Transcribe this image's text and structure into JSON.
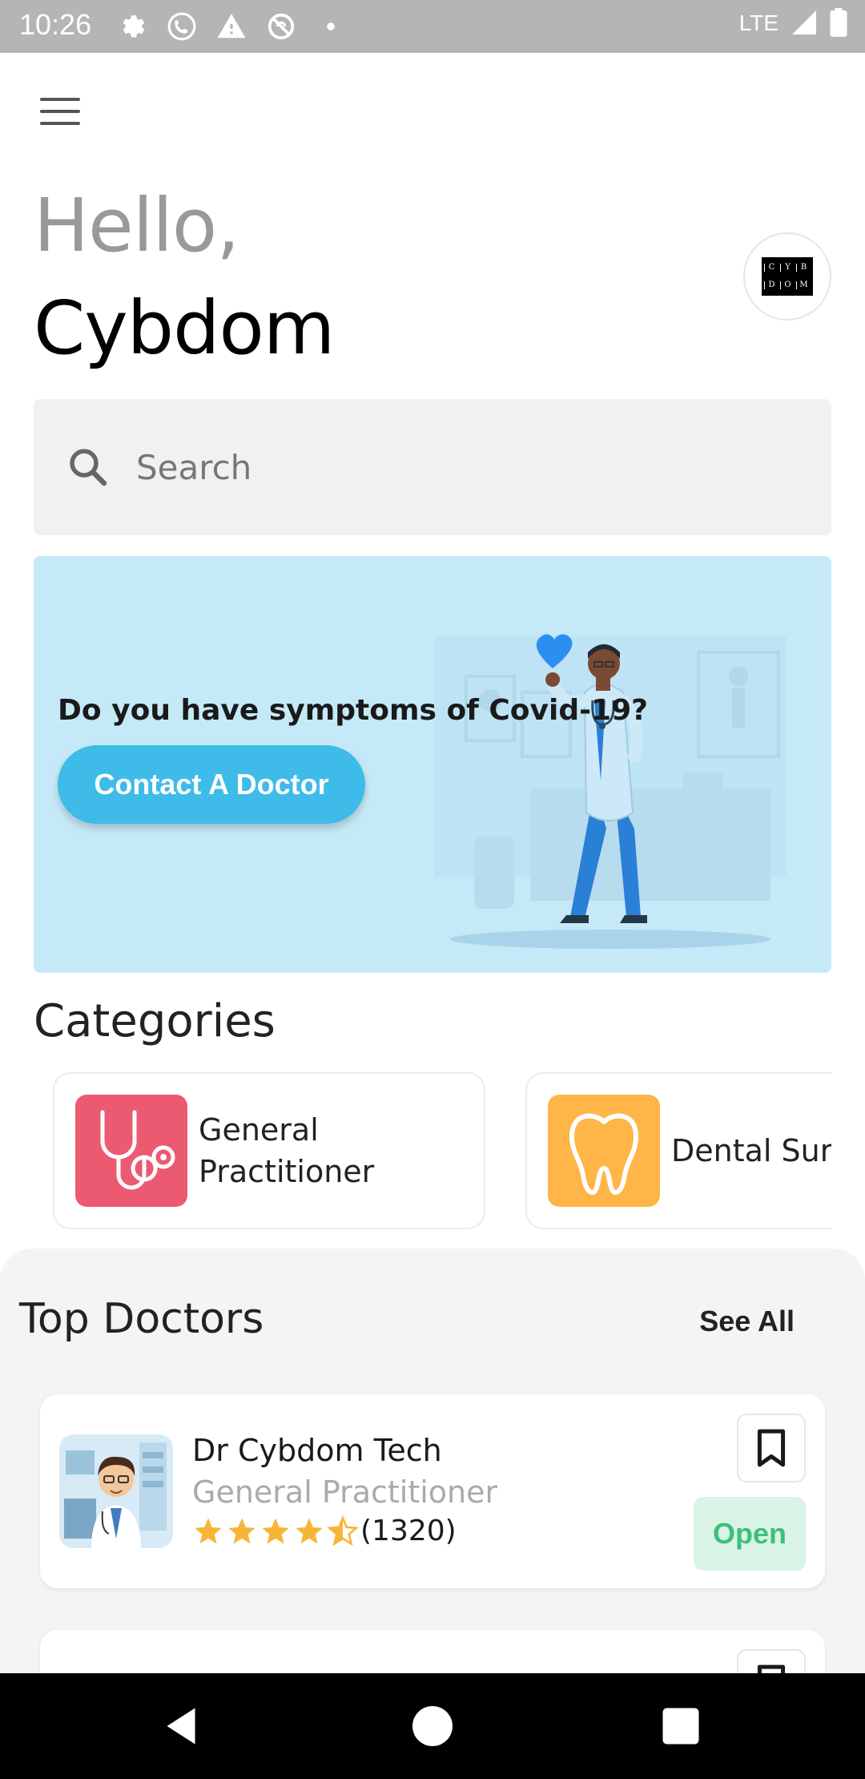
{
  "status_bar": {
    "time": "10:26",
    "network": "LTE",
    "icons": [
      "settings-icon",
      "phone-icon",
      "warning-icon",
      "sync-disabled-icon",
      "dot-icon",
      "signal-icon",
      "battery-icon"
    ]
  },
  "header": {
    "greeting": "Hello,",
    "user_name": "Cybdom",
    "avatar_letters": [
      "C",
      "Y",
      "B",
      "D",
      "O",
      "M"
    ]
  },
  "search": {
    "placeholder": "Search"
  },
  "banner": {
    "title": "Do you have symptoms of Covid-19?",
    "button_label": "Contact A Doctor",
    "background": "#c6e9f8",
    "button_color": "#3ebbe8"
  },
  "categories": {
    "title": "Categories",
    "items": [
      {
        "label_line1": "General",
        "label_line2": "Practitioner",
        "icon": "stethoscope-icon",
        "color": "#ec5a72"
      },
      {
        "label_line1": "Dental Surgeon",
        "icon": "tooth-icon",
        "color": "#ffb547"
      }
    ]
  },
  "top_doctors": {
    "title": "Top Doctors",
    "see_all": "See All",
    "doctors": [
      {
        "name": "Dr Cybdom Tech",
        "specialty": "General Practitioner",
        "rating": 4.5,
        "reviews": "(1320)",
        "status": "Open"
      }
    ]
  },
  "colors": {
    "star": "#f7b538",
    "open_text": "#3dbf7c",
    "open_bg": "#d9f3e6"
  }
}
